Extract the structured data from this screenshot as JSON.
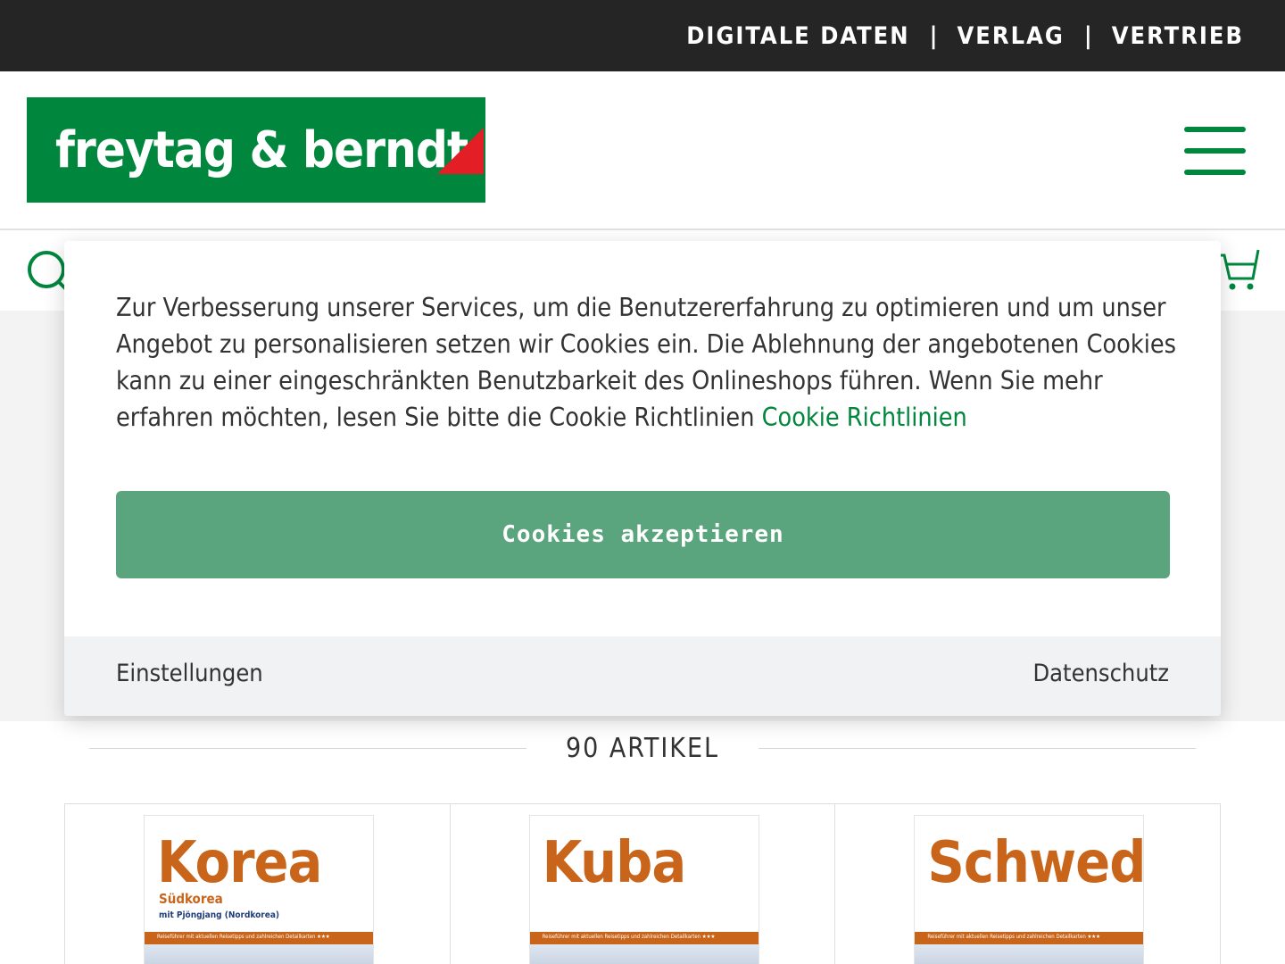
{
  "topbar": {
    "links": [
      "Digitale Daten",
      "Verlag",
      "Vertrieb"
    ],
    "separator": "|"
  },
  "header": {
    "logo_text": "freytag & berndt",
    "brand_green": "#00873d",
    "brand_red": "#e31e24",
    "menu_icon": "hamburger-menu-icon"
  },
  "searchbar": {
    "search_icon": "search-icon",
    "cart_icon": "cart-icon"
  },
  "listing": {
    "article_count": "90 Artikel",
    "products": [
      {
        "title": "Korea",
        "subtitle": "Südkorea",
        "subtitle2": "mit Pjöngjang (Nordkorea)",
        "band": "Reiseführer mit aktuellen Reisetipps und zahlreichen Detailkarten ★★★"
      },
      {
        "title": "Kuba",
        "subtitle": "",
        "subtitle2": "",
        "band": "Reiseführer mit aktuellen Reisetipps und zahlreichen Detailkarten ★★★"
      },
      {
        "title": "Schweden",
        "subtitle": "",
        "subtitle2": "",
        "band": "Reiseführer mit aktuellen Reisetipps und zahlreichen Detailkarten ★★★"
      }
    ]
  },
  "cookie_modal": {
    "text": "Zur Verbesserung unserer Services, um die Benutzererfahrung zu optimieren und um unser Angebot zu personalisieren setzen wir Cookies ein. Die Ablehnung der angebotenen Cookies kann zu einer eingeschränkten Benutzbarkeit des Onlineshops führen. Wenn Sie mehr erfahren möchten, lesen Sie bitte die Cookie Richtlinien",
    "link_text": "Cookie Richtlinien",
    "accept_label": "Cookies akzeptieren",
    "accept_color": "#5aa57e",
    "settings_label": "Einstellungen",
    "privacy_label": "Datenschutz"
  }
}
